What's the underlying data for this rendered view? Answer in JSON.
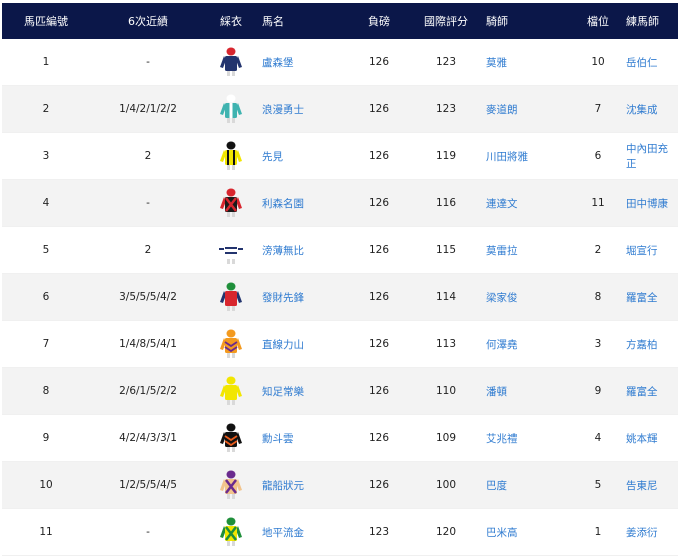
{
  "headers": {
    "horse_no": "馬匹編號",
    "last6": "6次近績",
    "colours": "綵衣",
    "horse": "馬名",
    "weight": "負磅",
    "rating": "國際評分",
    "jockey": "騎師",
    "draw": "檔位",
    "trainer": "練馬師"
  },
  "runners": [
    {
      "no": "1",
      "last6": "-",
      "horse": "盧森堡",
      "weight": "126",
      "rating": "123",
      "jockey": "莫雅",
      "draw": "10",
      "trainer": "岳伯仁",
      "silk": {
        "cap": "#d8262e",
        "body": "#23346e",
        "sleeves": "#23346e",
        "accent": "#d8262e",
        "pattern": "plain"
      }
    },
    {
      "no": "2",
      "last6": "1/4/2/1/2/2",
      "horse": "浪漫勇士",
      "weight": "126",
      "rating": "123",
      "jockey": "麥道朗",
      "draw": "7",
      "trainer": "沈集成",
      "silk": {
        "cap": "#ffffff",
        "body": "#3fb3b0",
        "sleeves": "#3fb3b0",
        "accent": "#ffffff",
        "pattern": "stripe"
      }
    },
    {
      "no": "3",
      "last6": "2",
      "horse": "先見",
      "weight": "126",
      "rating": "119",
      "jockey": "川田將雅",
      "draw": "6",
      "trainer": "中內田充正",
      "silk": {
        "cap": "#111111",
        "body": "#f2e600",
        "sleeves": "#f2e600",
        "accent": "#111111",
        "pattern": "stripes"
      }
    },
    {
      "no": "4",
      "last6": "-",
      "horse": "利森名園",
      "weight": "126",
      "rating": "116",
      "jockey": "連達文",
      "draw": "11",
      "trainer": "田中博康",
      "silk": {
        "cap": "#d8262e",
        "body": "#1a1a1a",
        "sleeves": "#d8262e",
        "accent": "#d8262e",
        "pattern": "cross"
      }
    },
    {
      "no": "5",
      "last6": "2",
      "horse": "滂薄無比",
      "weight": "126",
      "rating": "115",
      "jockey": "莫雷拉",
      "draw": "2",
      "trainer": "堀宣行",
      "silk": {
        "cap": "#ffffff",
        "body": "#ffffff",
        "sleeves": "#ffffff",
        "accent": "#23346e",
        "pattern": "hoops"
      }
    },
    {
      "no": "6",
      "last6": "3/5/5/5/4/2",
      "horse": "發財先鋒",
      "weight": "126",
      "rating": "114",
      "jockey": "梁家俊",
      "draw": "8",
      "trainer": "羅富全",
      "silk": {
        "cap": "#1f8f3a",
        "body": "#d8262e",
        "sleeves": "#23346e",
        "accent": "#1f8f3a",
        "pattern": "plain"
      }
    },
    {
      "no": "7",
      "last6": "1/4/8/5/4/1",
      "horse": "直線力山",
      "weight": "126",
      "rating": "113",
      "jockey": "何澤堯",
      "draw": "3",
      "trainer": "方嘉柏",
      "silk": {
        "cap": "#f39a1f",
        "body": "#f39a1f",
        "sleeves": "#f39a1f",
        "accent": "#6a2b8e",
        "pattern": "chevrons"
      }
    },
    {
      "no": "8",
      "last6": "2/6/1/5/2/2",
      "horse": "知足常樂",
      "weight": "126",
      "rating": "110",
      "jockey": "潘頓",
      "draw": "9",
      "trainer": "羅富全",
      "silk": {
        "cap": "#f2e600",
        "body": "#f2e600",
        "sleeves": "#f2e600",
        "accent": "#c9b800",
        "pattern": "plain"
      }
    },
    {
      "no": "9",
      "last6": "4/2/4/3/3/1",
      "horse": "勳斗雲",
      "weight": "126",
      "rating": "109",
      "jockey": "艾兆禮",
      "draw": "4",
      "trainer": "姚本輝",
      "silk": {
        "cap": "#111111",
        "body": "#111111",
        "sleeves": "#111111",
        "accent": "#e85b1c",
        "pattern": "chevrons"
      }
    },
    {
      "no": "10",
      "last6": "1/2/5/5/4/5",
      "horse": "龍船狀元",
      "weight": "126",
      "rating": "100",
      "jockey": "巴度",
      "draw": "5",
      "trainer": "告東尼",
      "silk": {
        "cap": "#6a2b8e",
        "body": "#f2c48c",
        "sleeves": "#f2c48c",
        "accent": "#6a2b8e",
        "pattern": "cross"
      }
    },
    {
      "no": "11",
      "last6": "-",
      "horse": "地平流金",
      "weight": "123",
      "rating": "120",
      "jockey": "巴米高",
      "draw": "1",
      "trainer": "姜添衍",
      "silk": {
        "cap": "#1f8f3a",
        "body": "#f2e600",
        "sleeves": "#1f8f3a",
        "accent": "#1f8f3a",
        "pattern": "cross"
      }
    }
  ]
}
